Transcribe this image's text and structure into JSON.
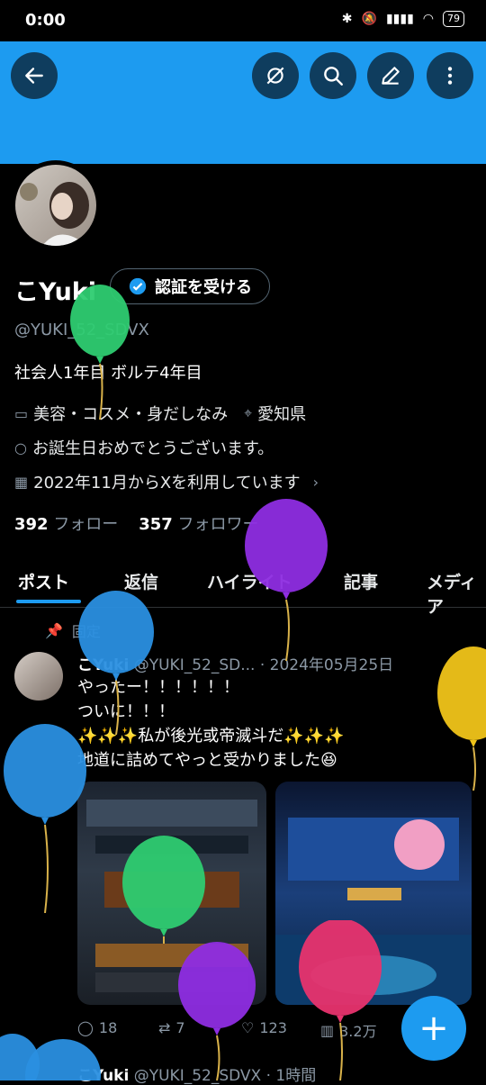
{
  "status": {
    "time": "0:00",
    "battery": "79"
  },
  "profile": {
    "name": "こYuki",
    "verify_label": "認証を受ける",
    "handle": "@YUKI_52_SDVX",
    "bio": "社会人1年目 ボルテ4年目",
    "category": "美容・コスメ・身だしなみ",
    "location": "愛知県",
    "birthday": "お誕生日おめでとうございます。",
    "joined": "2022年11月からXを利用しています",
    "following_count": "392",
    "following_label": "フォロー",
    "followers_count": "357",
    "followers_label": "フォロワー"
  },
  "tabs": [
    "ポスト",
    "返信",
    "ハイライト",
    "記事",
    "メディア"
  ],
  "post": {
    "pinned_label": "固定",
    "author": "こYuki",
    "handle_date": "@YUKI_52_SD... · 2024年05月25日",
    "text": "やったー！！！！！！\nついに！！！\n✨✨✨私が後光或帝滅斗だ✨✨✨\n地道に詰めてやっと受かりました😆",
    "replies": "18",
    "reposts": "7",
    "likes": "123",
    "views": "3.2万"
  },
  "next_post": {
    "author": "こYuki",
    "handle_time": "@YUKI_52_SDVX · 1時間"
  },
  "icons": [
    "back-arrow-icon",
    "hide-icon",
    "search-icon",
    "edit-icon",
    "more-icon",
    "plus-icon"
  ],
  "colors": {
    "accent": "#1d9bf0",
    "banner": "#1d9bf0"
  }
}
